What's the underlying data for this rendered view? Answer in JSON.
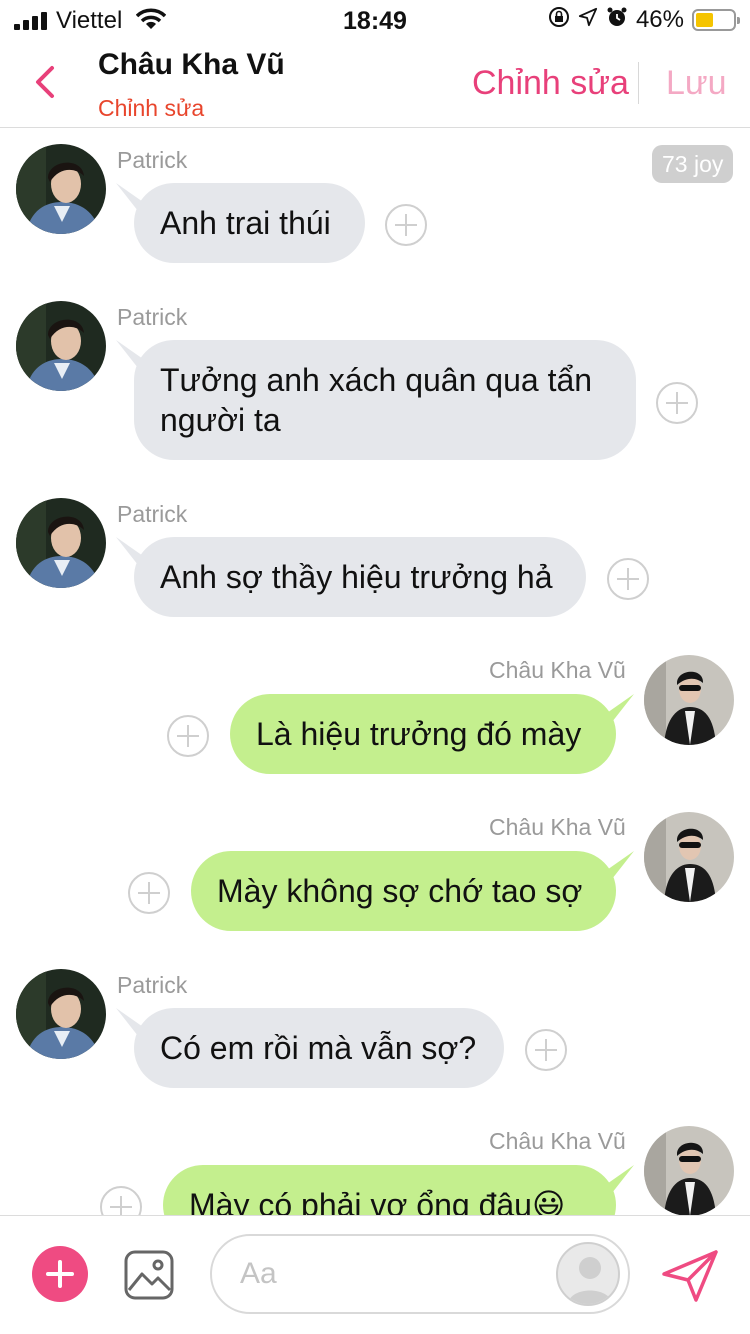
{
  "status_bar": {
    "carrier": "Viettel",
    "time": "18:49",
    "battery_percent": "46%",
    "battery_level": 0.46,
    "icons": [
      "signal-icon",
      "wifi-icon",
      "orientation-lock-icon",
      "location-icon",
      "alarm-icon",
      "battery-icon"
    ]
  },
  "header": {
    "contact_name": "Châu Kha Vũ",
    "subtitle": "Chỉnh sửa",
    "edit_label": "Chỉnh sửa",
    "save_label": "Lưu",
    "accent_color": "#e8407a"
  },
  "joy_badge": "73 joy",
  "messages": [
    {
      "direction": "incoming",
      "sender": "Patrick",
      "text": "Anh trai thúi"
    },
    {
      "direction": "incoming",
      "sender": "Patrick",
      "text": "Tưởng anh xách quân qua tẩn người ta"
    },
    {
      "direction": "incoming",
      "sender": "Patrick",
      "text": "Anh sợ thầy hiệu trưởng hả"
    },
    {
      "direction": "outgoing",
      "sender": "Châu Kha Vũ",
      "text": "Là hiệu trưởng đó mày"
    },
    {
      "direction": "outgoing",
      "sender": "Châu Kha Vũ",
      "text": "Mày không sợ chớ tao sợ"
    },
    {
      "direction": "incoming",
      "sender": "Patrick",
      "text": "Có em rồi mà vẫn sợ?"
    },
    {
      "direction": "outgoing",
      "sender": "Châu Kha Vũ",
      "text": "Mày có phải vợ ổng đâu😃"
    }
  ],
  "composer": {
    "placeholder": "Aa",
    "value": ""
  },
  "colors": {
    "incoming_bubble": "#e5e7eb",
    "outgoing_bubble": "#c4ef8e",
    "add_button": "#ef4b82"
  }
}
